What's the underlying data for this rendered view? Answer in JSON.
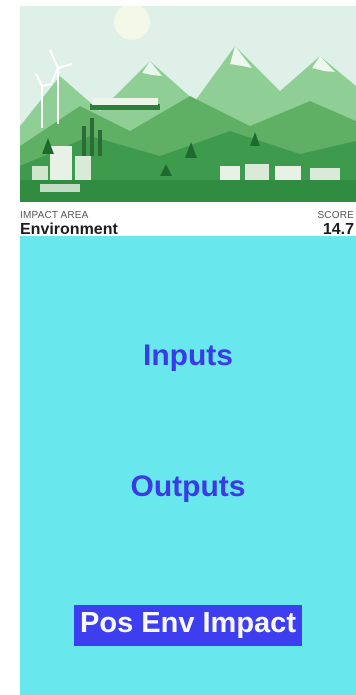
{
  "card": {
    "impact_area_label": "IMPACT AREA",
    "impact_area_value": "Environment",
    "score_label": "SCORE",
    "score_value": "14.7"
  },
  "panel": {
    "inputs_label": "Inputs",
    "outputs_label": "Outputs",
    "impact_label": "Pos Env Impact"
  },
  "colors": {
    "panel_background": "#68e8ec",
    "link_text": "#3a3ae6",
    "highlight_background": "#3d3ef0"
  }
}
